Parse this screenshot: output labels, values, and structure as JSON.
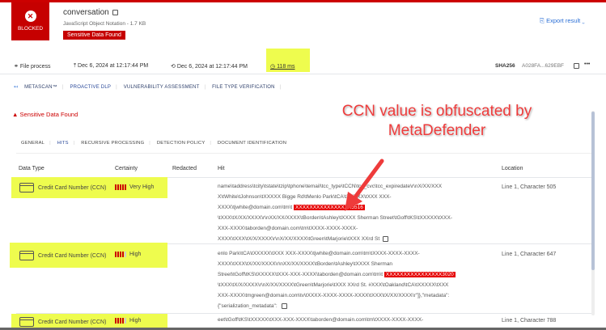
{
  "header": {
    "status": "BLOCKED",
    "file_name": "conversation",
    "file_info": "JavaScript Object Notation - 1.7 KB",
    "badge": "Sensitive Data Found",
    "export": "Export result"
  },
  "meta": {
    "process": "File process",
    "upload": "Dec 6, 2024 at 12:17:44 PM",
    "processed": "Dec 6, 2024 at 12:17:44 PM",
    "duration": "118 ms",
    "hash_label": "SHA256",
    "hash_value": "A028FA...629EBF",
    "more": "•••"
  },
  "tabs": [
    "METASCAN™",
    "PROACTIVE DLP",
    "VULNERABILITY ASSESSMENT",
    "FILE TYPE VERIFICATION"
  ],
  "alert": "Sensitive Data Found",
  "subtabs": [
    "GENERAL",
    "HITS",
    "RECURSIVE PROCESSING",
    "DETECTION POLICY",
    "DOCUMENT IDENTIFICATION"
  ],
  "columns": [
    "Data Type",
    "Certainty",
    "Redacted",
    "Hit",
    "Location"
  ],
  "rows": [
    {
      "type": "Credit Card Number (CCN)",
      "certainty": "Very High",
      "level": 5,
      "location": "Line 1, Character 505",
      "lines": [
        "name\\taddress\\tcity\\tstate\\tzip\\tphone\\temail\\tcc_type\\tCCN\\tcc_cvc\\tcc_expiredate\\r\\nX/XX/XXX",
        "X\\tWhite\\tJohnson\\tXXXXX Bigge Rd\\tMenlo Park\\tCA\\tXXXXX\\tXXX XXX-",
        "XXXX\\tjwhite@domain.com\\tm\\t ",
        " \\tXXX\\tX/XX/XXXX\\r\\nXX/XX/XXXX\\tBorden\\tAshley\\tXXXX Sherman Street\\tGoff\\tKS\\tXXXXX\\tXXX-",
        "XXX-XXXX\\taborden@domain.com\\tm\\tXXXX-XXXX-XXXX-",
        "XXXX\\tXXX\\tX/X/XXXX\\r\\nX/XX/XXXX\\tGreen\\tMarjorie\\tXXX XXrd St"
      ],
      "masked": "XXXXXXXXXXXXXXXX5516"
    },
    {
      "type": "Credit Card Number (CCN)",
      "certainty": "High",
      "level": 4,
      "location": "Line 1, Character 647",
      "lines": [
        "enlo Park\\tCA\\tXXXXX\\tXXX XXX-XXXX\\tjwhite@domain.com\\tm\\tXXXX-XXXX-XXXX-",
        "XXXX\\tXXX\\tX/XX/XXXX\\r\\nXX/XX/XXXX\\tBorden\\tAshley\\tXXXX Sherman",
        "Street\\tGoff\\tKS\\tXXXXX\\tXXX-XXX-XXXX\\taborden@domain.com\\tm\\t ",
        " \\tXXX\\tX/X/XXXX\\r\\nX/XX/XXXX\\tGreen\\tMarjorie\\tXXX XXrd St. #XXX\\tOakland\\tCA\\tXXXXX\\tXXX",
        "XXX-XXXX\\tmgreen@domain.com\\tv\\tXXXX-XXXX-XXXX-XXXX\\tXXX\\tX/XX/XXXX\\r\"]},\"metadata\":",
        "{\"serialization_metadata\": "
      ],
      "masked": "XXXXXXXXXXXXXXXX3020"
    },
    {
      "type": "Credit Card Number (CCN)",
      "certainty": "High",
      "level": 4,
      "location": "Line 1, Character 788",
      "lines": [
        "eet\\tGoff\\tKS\\tXXXXX\\tXXX-XXX-XXXX\\taborden@domain.com\\tm\\tXXXX-XXXX-XXXX-"
      ]
    }
  ],
  "annotation": {
    "line1": "CCN value is obfuscated by",
    "line2": "MetaDefender"
  },
  "colors": {
    "brand_red": "#c60000",
    "highlight": "#eefc4e",
    "link": "#2b6fd6"
  }
}
